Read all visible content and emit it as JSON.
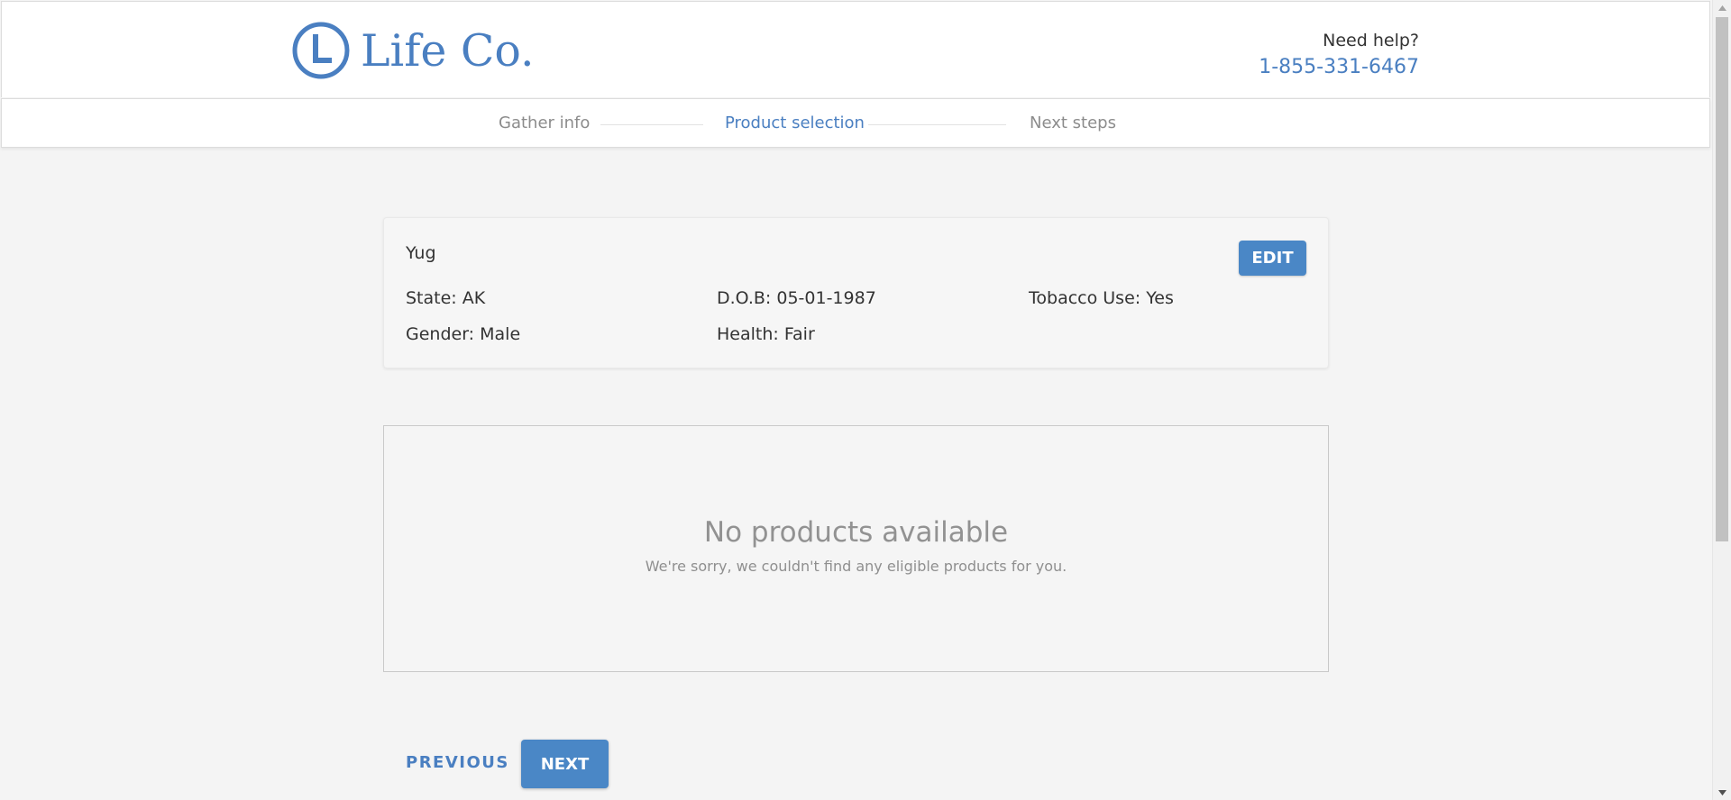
{
  "header": {
    "logo_text": "Life Co.",
    "help_label": "Need help?",
    "help_phone": "1-855-331-6467",
    "brand_color": "#4a7fc1"
  },
  "steps": [
    {
      "label": "Gather info",
      "state": "inactive"
    },
    {
      "label": "Product selection",
      "state": "active"
    },
    {
      "label": "Next steps",
      "state": "inactive"
    }
  ],
  "summary": {
    "name": "Yug",
    "edit_label": "EDIT",
    "state": "State: AK",
    "dob": "D.O.B: 05-01-1987",
    "tobacco": "Tobacco Use: Yes",
    "gender": "Gender: Male",
    "health": "Health: Fair"
  },
  "empty_state": {
    "title": "No products available",
    "subtitle": "We're sorry, we couldn't find any eligible products for you."
  },
  "nav": {
    "previous_label": "PREVIOUS",
    "next_label": "NEXT"
  },
  "icons": {
    "logo": "clock-l-logo-icon",
    "scroll_up": "arrow-up-icon",
    "scroll_down": "arrow-down-icon"
  }
}
